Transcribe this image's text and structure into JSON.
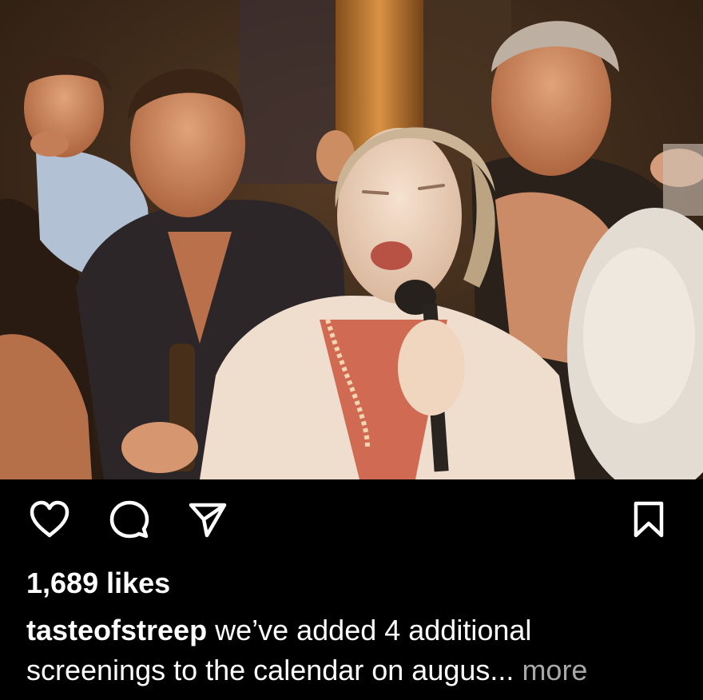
{
  "post": {
    "username": "tasteofstreep",
    "likes_text": "1,689 likes",
    "caption_line1": "we’ve added 4 additional",
    "caption_line2": "screenings to the calendar on augus",
    "ellipsis": "...",
    "more_label": "more"
  },
  "icons": {
    "like": "heart-outline-icon",
    "comment": "speech-bubble-icon",
    "share": "paper-plane-icon",
    "save": "bookmark-outline-icon"
  },
  "colors": {
    "background": "#000000",
    "text": "#ffffff",
    "muted_text": "#a8a8a8"
  }
}
